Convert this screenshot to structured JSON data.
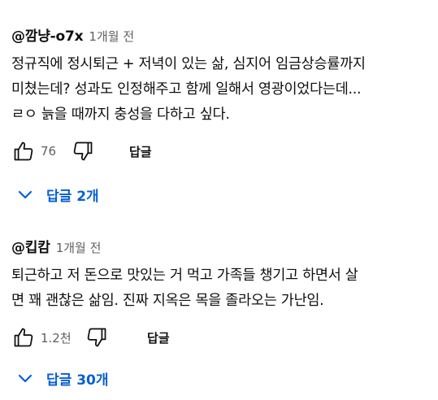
{
  "comments": [
    {
      "author": "@깜냥-o7x",
      "time": "1개월 전",
      "text": "정규직에 정시퇴근 + 저녁이 있는 삶, 심지어 임금상승률까지\n미쳤는데? 성과도 인정해주고 함께 일해서 영광이었다는데...\nㄹㅇ 늙을 때까지 충성을 다하고 싶다.",
      "likes": "76",
      "reply_label": "답글",
      "replies_label": "답글 2개"
    },
    {
      "author": "@킵캄",
      "time": "1개월 전",
      "text": "퇴근하고 저 돈으로 맛있는 거 먹고 가족들 챙기고 하면서 살\n면 꽤 괜찮은 삶임. 진짜 지옥은 목을 졸라오는 가난임.",
      "likes": "1.2천",
      "reply_label": "답글",
      "replies_label": "답글 30개"
    }
  ],
  "icons": {
    "like": "thumbs-up-outline-icon",
    "dislike": "thumbs-down-outline-icon",
    "expand": "chevron-down-icon"
  },
  "colors": {
    "replies_link": "#065fd4",
    "meta_text": "#606060",
    "primary_text": "#0f0f0f"
  }
}
